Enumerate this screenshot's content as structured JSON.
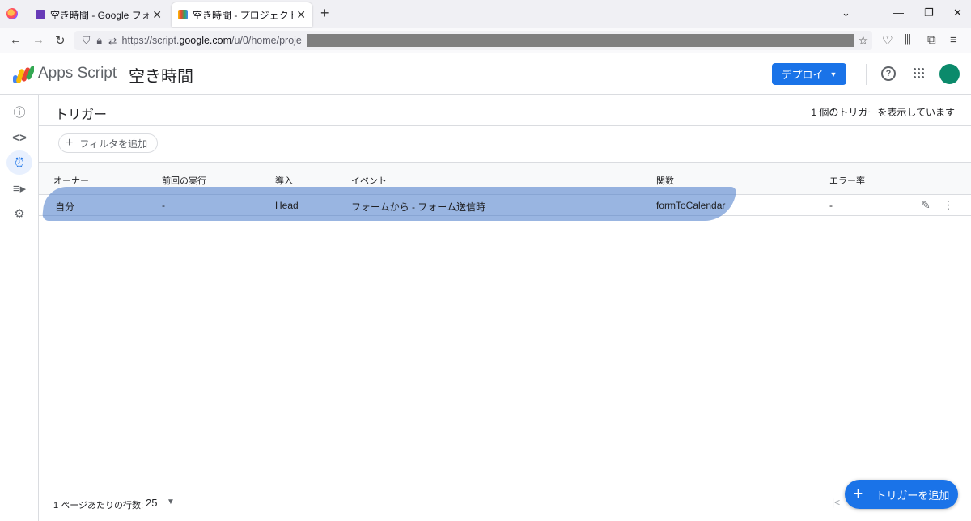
{
  "browser": {
    "tabs": [
      {
        "title": "空き時間 - Google フォーム"
      },
      {
        "title": "空き時間 - プロジェクトのトリガー - A"
      }
    ],
    "url_prefix": "https://script.",
    "url_host": "google.com",
    "url_path": "/u/0/home/proje"
  },
  "header": {
    "app_name": "Apps Script",
    "project_name": "空き時間",
    "deploy_label": "デプロイ",
    "help_glyph": "?"
  },
  "page": {
    "title": "トリガー",
    "count_text": "1 個のトリガーを表示しています",
    "filter_label": "フィルタを追加"
  },
  "table": {
    "columns": [
      "オーナー",
      "前回の実行",
      "導入",
      "イベント",
      "関数",
      "エラー率"
    ],
    "rows": [
      {
        "owner": "自分",
        "last_run": "-",
        "deployment": "Head",
        "event": "フォームから - フォーム送信時",
        "function": "formToCalendar",
        "error_rate": "-"
      }
    ]
  },
  "footer": {
    "rows_per_page_label": "1 ページあたりの行数:",
    "rows_per_page_value": "25",
    "add_trigger_label": "トリガーを追加"
  },
  "colors": {
    "accent": "#1a73e8",
    "avatar": "#0b8a6b",
    "highlight": "#4678c8"
  }
}
